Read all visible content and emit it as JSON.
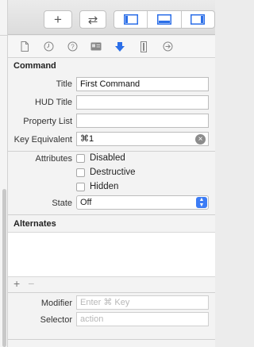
{
  "toolbar": {
    "add_label": "+",
    "swap_label": "⇄"
  },
  "tabs": [
    {
      "name": "file-inspector-icon",
      "glyph": "🗋"
    },
    {
      "name": "history-inspector-icon",
      "glyph": "◷"
    },
    {
      "name": "help-inspector-icon",
      "glyph": "?"
    },
    {
      "name": "identity-inspector-icon",
      "glyph": "▣"
    },
    {
      "name": "attributes-inspector-icon",
      "glyph": "⬇"
    },
    {
      "name": "size-inspector-icon",
      "glyph": "▯"
    },
    {
      "name": "connections-inspector-icon",
      "glyph": "→"
    }
  ],
  "command": {
    "section_title": "Command",
    "title_label": "Title",
    "title_value": "First Command",
    "hud_title_label": "HUD Title",
    "hud_title_value": "",
    "property_list_label": "Property List",
    "property_list_value": "",
    "key_equivalent_label": "Key Equivalent",
    "key_equivalent_value": "⌘1",
    "attributes_label": "Attributes",
    "attr_disabled": "Disabled",
    "attr_destructive": "Destructive",
    "attr_hidden": "Hidden",
    "state_label": "State",
    "state_value": "Off"
  },
  "alternates": {
    "section_title": "Alternates",
    "add_label": "+",
    "remove_label": "−",
    "modifier_label": "Modifier",
    "modifier_placeholder": "Enter ⌘ Key",
    "selector_label": "Selector",
    "selector_placeholder": "action"
  },
  "colors": {
    "accent": "#3c7cf5",
    "selected_tab": "#3c7cf5"
  }
}
